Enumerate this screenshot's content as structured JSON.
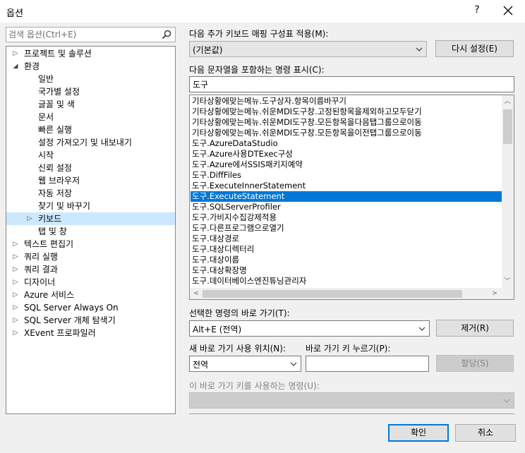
{
  "window": {
    "title": "옵션",
    "help_glyph": "?",
    "close_glyph": "✕"
  },
  "search": {
    "placeholder": "검색 옵션(Ctrl+E)"
  },
  "tree": [
    {
      "label": "프로젝트 및 솔루션",
      "level": 0,
      "arrow": "▷"
    },
    {
      "label": "환경",
      "level": 0,
      "arrow": "◢"
    },
    {
      "label": "일반",
      "level": 1,
      "arrow": ""
    },
    {
      "label": "국가별 설정",
      "level": 1,
      "arrow": ""
    },
    {
      "label": "글꼴 및 색",
      "level": 1,
      "arrow": ""
    },
    {
      "label": "문서",
      "level": 1,
      "arrow": ""
    },
    {
      "label": "빠른 실행",
      "level": 1,
      "arrow": ""
    },
    {
      "label": "설정 가져오기 및 내보내기",
      "level": 1,
      "arrow": ""
    },
    {
      "label": "시작",
      "level": 1,
      "arrow": ""
    },
    {
      "label": "신뢰 설정",
      "level": 1,
      "arrow": ""
    },
    {
      "label": "웹 브라우저",
      "level": 1,
      "arrow": ""
    },
    {
      "label": "자동 저장",
      "level": 1,
      "arrow": ""
    },
    {
      "label": "찾기 및 바꾸기",
      "level": 1,
      "arrow": ""
    },
    {
      "label": "키보드",
      "level": 1,
      "arrow": "▷",
      "selected": true
    },
    {
      "label": "탭 및 창",
      "level": 1,
      "arrow": ""
    },
    {
      "label": "텍스트 편집기",
      "level": 0,
      "arrow": "▷"
    },
    {
      "label": "쿼리 실행",
      "level": 0,
      "arrow": "▷"
    },
    {
      "label": "쿼리 결과",
      "level": 0,
      "arrow": "▷"
    },
    {
      "label": "디자이너",
      "level": 0,
      "arrow": "▷"
    },
    {
      "label": "Azure 서비스",
      "level": 0,
      "arrow": "▷"
    },
    {
      "label": "SQL Server Always On",
      "level": 0,
      "arrow": "▷"
    },
    {
      "label": "SQL Server 개체 탐색기",
      "level": 0,
      "arrow": "▷"
    },
    {
      "label": "XEvent 프로파일러",
      "level": 0,
      "arrow": "▷"
    }
  ],
  "mapping": {
    "label": "다음 추가 키보드 매핑 구성표 적용(M):",
    "value": "(기본값)",
    "reset_button": "다시 설정(E)"
  },
  "filter": {
    "label": "다음 문자열을 포함하는 명령 표시(C):",
    "value": "도구"
  },
  "commands": [
    "기타상황에맞는메뉴.도구상자.항목이름바꾸기",
    "기타상황에맞는메뉴.쉬운MDI도구창.고정된항목을제외하고모두닫기",
    "기타상황에맞는메뉴.쉬운MDI도구창.모든항목을다음탭그룹으로이동",
    "기타상황에맞는메뉴.쉬운MDI도구창.모든항목을이전탭그룹으로이동",
    "도구.AzureDataStudio",
    "도구.Azure사용DTExec구성",
    "도구.Azure에서SSIS패키지예약",
    "도구.DiffFiles",
    "도구.ExecuteInnerStatement",
    "도구.ExecuteStatement",
    "도구.SQLServerProfiler",
    "도구.가비지수집강제적용",
    "도구.다른프로그램으로열기",
    "도구.대상경로",
    "도구.대상디렉터리",
    "도구.대상이름",
    "도구.대상확장명",
    "도구.데이터베이스엔진튜닝관리자"
  ],
  "selected_command_index": 9,
  "shortcuts": {
    "label": "선택한 명령의 바로 가기(T):",
    "value": "Alt+E (전역)",
    "remove_button": "제거(R)"
  },
  "new_shortcut": {
    "scope_label": "새 바로 가기 사용 위치(N):",
    "scope_value": "전역",
    "keys_label": "바로 가기 키 누르기(P):",
    "keys_value": "",
    "assign_button": "할당(S)"
  },
  "used_by": {
    "label": "이 바로 가기 키를 사용하는 명령(U):",
    "value": ""
  },
  "footer": {
    "ok_button": "확인",
    "cancel_button": "취소"
  },
  "colors": {
    "selection": "#0078d7",
    "tree_selection": "#cce8ff",
    "accent_border": "#0078d7"
  }
}
